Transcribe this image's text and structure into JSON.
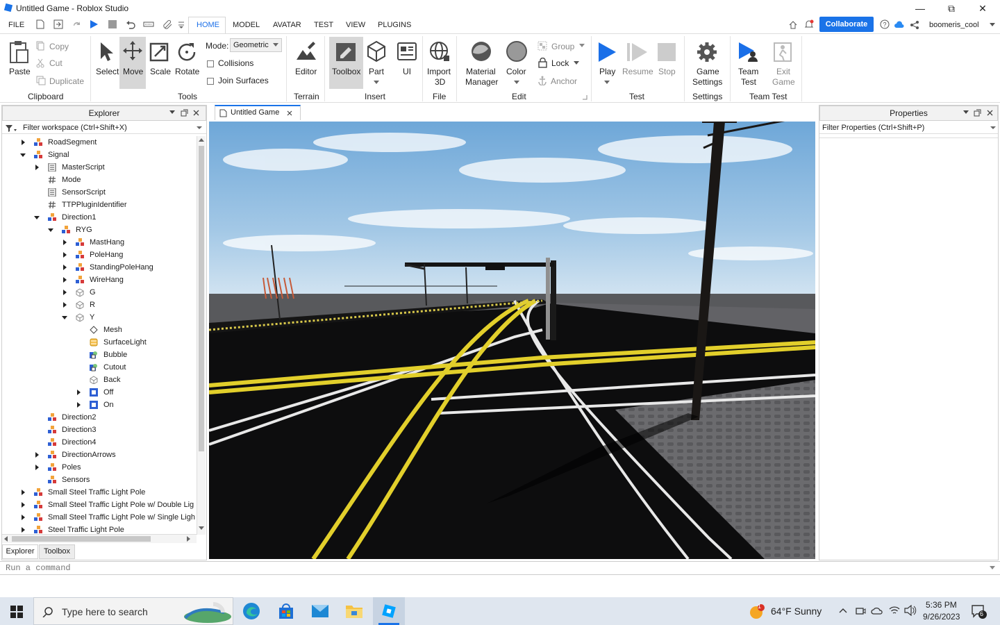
{
  "window": {
    "title": "Untitled Game - Roblox Studio"
  },
  "menu": {
    "file": "FILE",
    "tabs": [
      "HOME",
      "MODEL",
      "AVATAR",
      "TEST",
      "VIEW",
      "PLUGINS"
    ],
    "collaborate": "Collaborate",
    "username": "boomeris_cool"
  },
  "ribbon": {
    "paste": "Paste",
    "copy": "Copy",
    "cut": "Cut",
    "duplicate": "Duplicate",
    "clipboard_group": "Clipboard",
    "select": "Select",
    "move": "Move",
    "scale": "Scale",
    "rotate": "Rotate",
    "tools_group": "Tools",
    "mode_label": "Mode:",
    "mode_value": "Geometric",
    "collisions": "Collisions",
    "join_surfaces": "Join Surfaces",
    "editor": "Editor",
    "terrain_group": "Terrain",
    "toolbox": "Toolbox",
    "part": "Part",
    "ui": "UI",
    "insert_group": "Insert",
    "import3d_1": "Import",
    "import3d_2": "3D",
    "file_group": "File",
    "material_1": "Material",
    "material_2": "Manager",
    "color": "Color",
    "group": "Group",
    "lock": "Lock",
    "anchor": "Anchor",
    "edit_group": "Edit",
    "play": "Play",
    "resume": "Resume",
    "stop": "Stop",
    "test_group": "Test",
    "game_settings_1": "Game",
    "game_settings_2": "Settings",
    "settings_group": "Settings",
    "team_test_1": "Team",
    "team_test_2": "Test",
    "exit_game_1": "Exit",
    "exit_game_2": "Game",
    "team_test_group": "Team Test"
  },
  "explorer": {
    "title": "Explorer",
    "filter": "Filter workspace (Ctrl+Shift+X)",
    "items": [
      {
        "label": "RoadSegment",
        "depth": 1,
        "exp": "r",
        "icon": "model"
      },
      {
        "label": "Signal",
        "depth": 1,
        "exp": "d",
        "icon": "model"
      },
      {
        "label": "MasterScript",
        "depth": 2,
        "exp": "r",
        "icon": "script"
      },
      {
        "label": "Mode",
        "depth": 2,
        "exp": "",
        "icon": "value"
      },
      {
        "label": "SensorScript",
        "depth": 2,
        "exp": "",
        "icon": "script"
      },
      {
        "label": "TTPPluginIdentifier",
        "depth": 2,
        "exp": "",
        "icon": "value"
      },
      {
        "label": "Direction1",
        "depth": 2,
        "exp": "d",
        "icon": "model"
      },
      {
        "label": "RYG",
        "depth": 3,
        "exp": "d",
        "icon": "model"
      },
      {
        "label": "MastHang",
        "depth": 4,
        "exp": "r",
        "icon": "model"
      },
      {
        "label": "PoleHang",
        "depth": 4,
        "exp": "r",
        "icon": "model"
      },
      {
        "label": "StandingPoleHang",
        "depth": 4,
        "exp": "r",
        "icon": "model"
      },
      {
        "label": "WireHang",
        "depth": 4,
        "exp": "r",
        "icon": "model"
      },
      {
        "label": "G",
        "depth": 4,
        "exp": "r",
        "icon": "part"
      },
      {
        "label": "R",
        "depth": 4,
        "exp": "r",
        "icon": "part"
      },
      {
        "label": "Y",
        "depth": 4,
        "exp": "d",
        "icon": "part"
      },
      {
        "label": "Mesh",
        "depth": 5,
        "exp": "",
        "icon": "mesh"
      },
      {
        "label": "SurfaceLight",
        "depth": 5,
        "exp": "",
        "icon": "light"
      },
      {
        "label": "Bubble",
        "depth": 5,
        "exp": "",
        "icon": "decal"
      },
      {
        "label": "Cutout",
        "depth": 5,
        "exp": "",
        "icon": "decal"
      },
      {
        "label": "Back",
        "depth": 5,
        "exp": "",
        "icon": "part"
      },
      {
        "label": "Off",
        "depth": 5,
        "exp": "r",
        "icon": "gui"
      },
      {
        "label": "On",
        "depth": 5,
        "exp": "r",
        "icon": "gui"
      },
      {
        "label": "Direction2",
        "depth": 2,
        "exp": "",
        "icon": "model"
      },
      {
        "label": "Direction3",
        "depth": 2,
        "exp": "",
        "icon": "model"
      },
      {
        "label": "Direction4",
        "depth": 2,
        "exp": "",
        "icon": "model"
      },
      {
        "label": "DirectionArrows",
        "depth": 2,
        "exp": "r",
        "icon": "model"
      },
      {
        "label": "Poles",
        "depth": 2,
        "exp": "r",
        "icon": "model"
      },
      {
        "label": "Sensors",
        "depth": 2,
        "exp": "",
        "icon": "model"
      },
      {
        "label": "Small Steel Traffic Light Pole",
        "depth": 1,
        "exp": "r",
        "icon": "model"
      },
      {
        "label": "Small Steel Traffic Light Pole w/ Double Lig",
        "depth": 1,
        "exp": "r",
        "icon": "model"
      },
      {
        "label": "Small Steel Traffic Light Pole w/ Single Ligh",
        "depth": 1,
        "exp": "r",
        "icon": "model"
      },
      {
        "label": "Steel Traffic Light Pole",
        "depth": 1,
        "exp": "r",
        "icon": "model"
      }
    ],
    "tab_explorer": "Explorer",
    "tab_toolbox": "Toolbox"
  },
  "document_tab": "Untitled Game",
  "properties": {
    "title": "Properties",
    "filter": "Filter Properties (Ctrl+Shift+P)"
  },
  "command_bar": {
    "placeholder": "Run a command"
  },
  "taskbar": {
    "search": "Type here to search",
    "weather": "64°F  Sunny",
    "time": "5:36 PM",
    "date": "9/26/2023",
    "notif_count": "6",
    "weather_badge": "1"
  }
}
